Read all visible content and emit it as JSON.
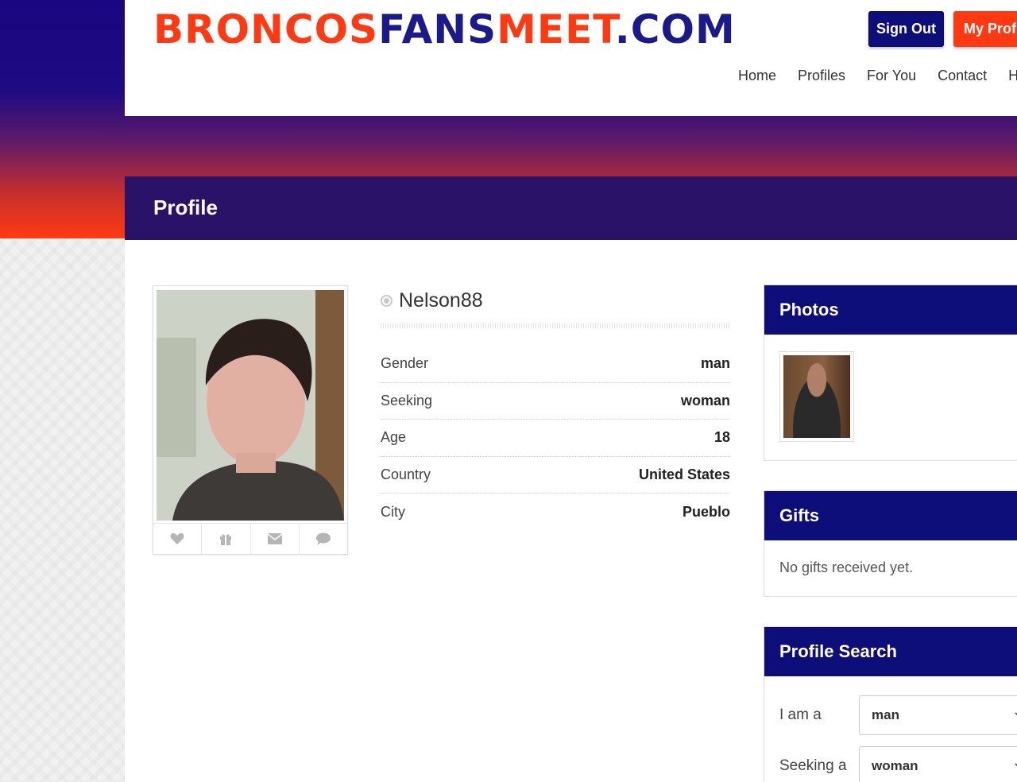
{
  "site": {
    "logo_parts": [
      "BRONCOS",
      "FANS",
      "MEET",
      ".COM"
    ],
    "sign_out_label": "Sign Out",
    "my_profile_label": "My Profile",
    "nav": [
      "Home",
      "Profiles",
      "For You",
      "Contact",
      "Help"
    ]
  },
  "page": {
    "title": "Profile"
  },
  "profile": {
    "username": "Nelson88",
    "status": "offline",
    "details": [
      {
        "label": "Gender",
        "value": "man"
      },
      {
        "label": "Seeking",
        "value": "woman"
      },
      {
        "label": "Age",
        "value": "18"
      },
      {
        "label": "Country",
        "value": "United States"
      },
      {
        "label": "City",
        "value": "Pueblo"
      }
    ],
    "actions": [
      "heart-icon",
      "gift-icon",
      "envelope-icon",
      "chat-bubble-icon"
    ]
  },
  "sidebar": {
    "photos": {
      "title": "Photos"
    },
    "gifts": {
      "title": "Gifts",
      "empty_text": "No gifts received yet."
    },
    "search": {
      "title": "Profile Search",
      "i_am_label": "I am a",
      "i_am_value": "man",
      "seeking_label": "Seeking a",
      "seeking_value": "woman"
    }
  },
  "colors": {
    "brand_orange": "#ff3a12",
    "brand_navy": "#0e0e7a",
    "profile_bar": "#2a1268"
  }
}
